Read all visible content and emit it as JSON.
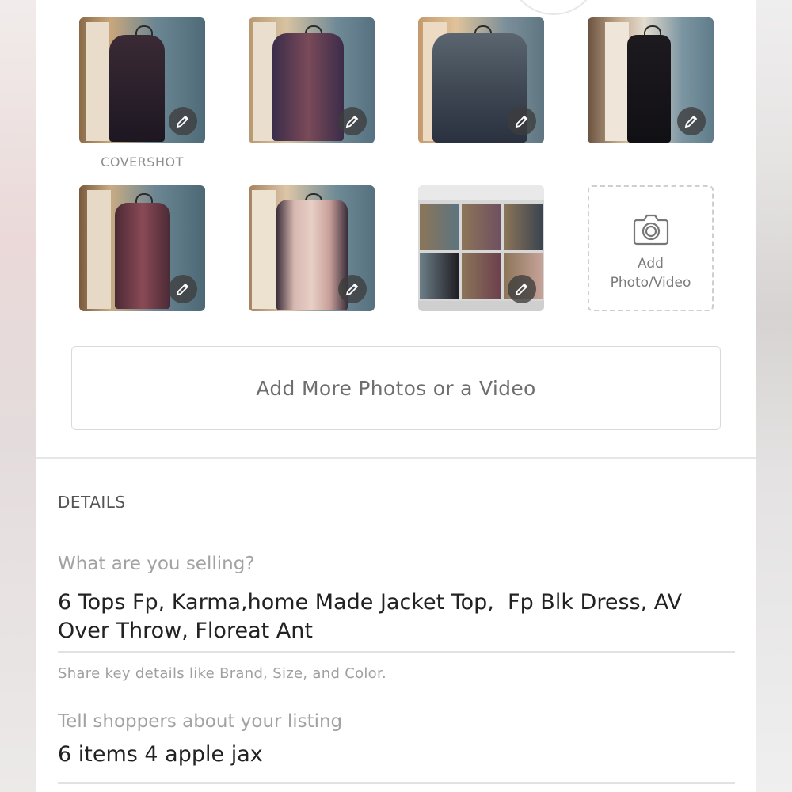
{
  "photos": {
    "cover_label": "COVERSHOT",
    "items": [
      {
        "name": "photo-1",
        "icon": "pencil-icon"
      },
      {
        "name": "photo-2",
        "icon": "pencil-icon"
      },
      {
        "name": "photo-3",
        "icon": "pencil-icon"
      },
      {
        "name": "photo-4",
        "icon": "pencil-icon"
      },
      {
        "name": "photo-5",
        "icon": "pencil-icon"
      },
      {
        "name": "photo-6",
        "icon": "pencil-icon"
      },
      {
        "name": "photo-7",
        "icon": "pencil-icon"
      }
    ],
    "add_tile_label": "Add\nPhoto/Video",
    "add_tile_icon": "camera-icon",
    "add_more_label": "Add More Photos or a Video"
  },
  "details": {
    "section_title": "DETAILS",
    "selling_label": "What are you selling?",
    "selling_value": "6 Tops Fp, Karma,home Made Jacket Top,  Fp Blk Dress, AV Over Throw, Floreat Ant",
    "hint": "Share key details like Brand, Size, and Color.",
    "description_label": "Tell shoppers about your listing",
    "description_value": "6 items 4 apple jax"
  },
  "colors": {
    "panel": "#ffffff",
    "label_gray": "#a2a2a2",
    "text_dark": "#222222",
    "border": "#d9d9d9"
  }
}
